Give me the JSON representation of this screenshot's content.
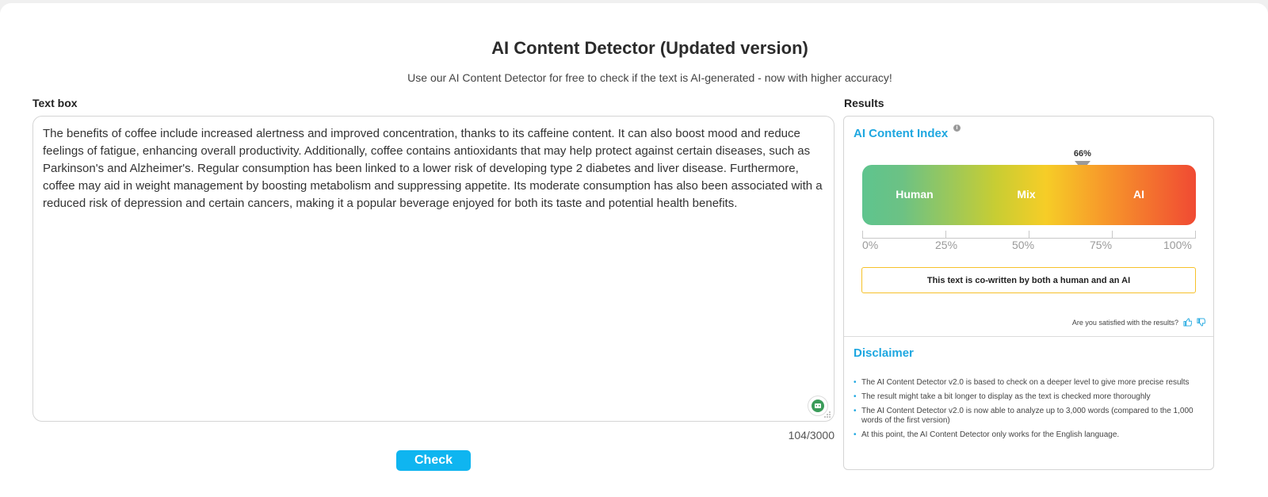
{
  "header": {
    "title": "AI Content Detector (Updated version)",
    "subtitle": "Use our AI Content Detector for free to check if the text is AI-generated - now with higher accuracy!"
  },
  "text_box": {
    "label": "Text box",
    "value": "The benefits of coffee include increased alertness and improved concentration, thanks to its caffeine content. It can also boost mood and reduce feelings of fatigue, enhancing overall productivity. Additionally, coffee contains antioxidants that may help protect against certain diseases, such as Parkinson's and Alzheimer's. Regular consumption has been linked to a lower risk of developing type 2 diabetes and liver disease. Furthermore, coffee may aid in weight management by boosting metabolism and suppressing appetite. Its moderate consumption has also been associated with a reduced risk of depression and certain cancers, making it a popular beverage enjoyed for both its taste and potential health benefits.",
    "word_count": "104/3000",
    "icon": "grammar-check-icon"
  },
  "check_button": {
    "label": "Check",
    "color": "#0fb5f0"
  },
  "results": {
    "label": "Results",
    "index_title": "AI Content Index",
    "score_label": "66%",
    "score_value": 66,
    "gauge_labels": {
      "human": "Human",
      "mix": "Mix",
      "ai": "AI"
    },
    "scale": [
      "0%",
      "25%",
      "50%",
      "75%",
      "100%"
    ],
    "verdict": "This text is co-written by both a human and an AI",
    "feedback_question": "Are you satisfied with the results?",
    "colors": {
      "accent": "#1ea7e0",
      "human": "#5ec48e",
      "mix": "#f6cd27",
      "ai": "#f04a33",
      "verdict_border": "#f6c12a"
    }
  },
  "disclaimer": {
    "title": "Disclaimer",
    "items": [
      "The AI Content Detector v2.0 is based to check on a deeper level to give more precise results",
      "The result might take a bit longer to display as the text is checked more thoroughly",
      "The AI Content Detector v2.0 is now able to analyze up to 3,000 words (compared to the 1,000 words of the first version)",
      "At this point, the AI Content Detector only works for the English language."
    ]
  }
}
